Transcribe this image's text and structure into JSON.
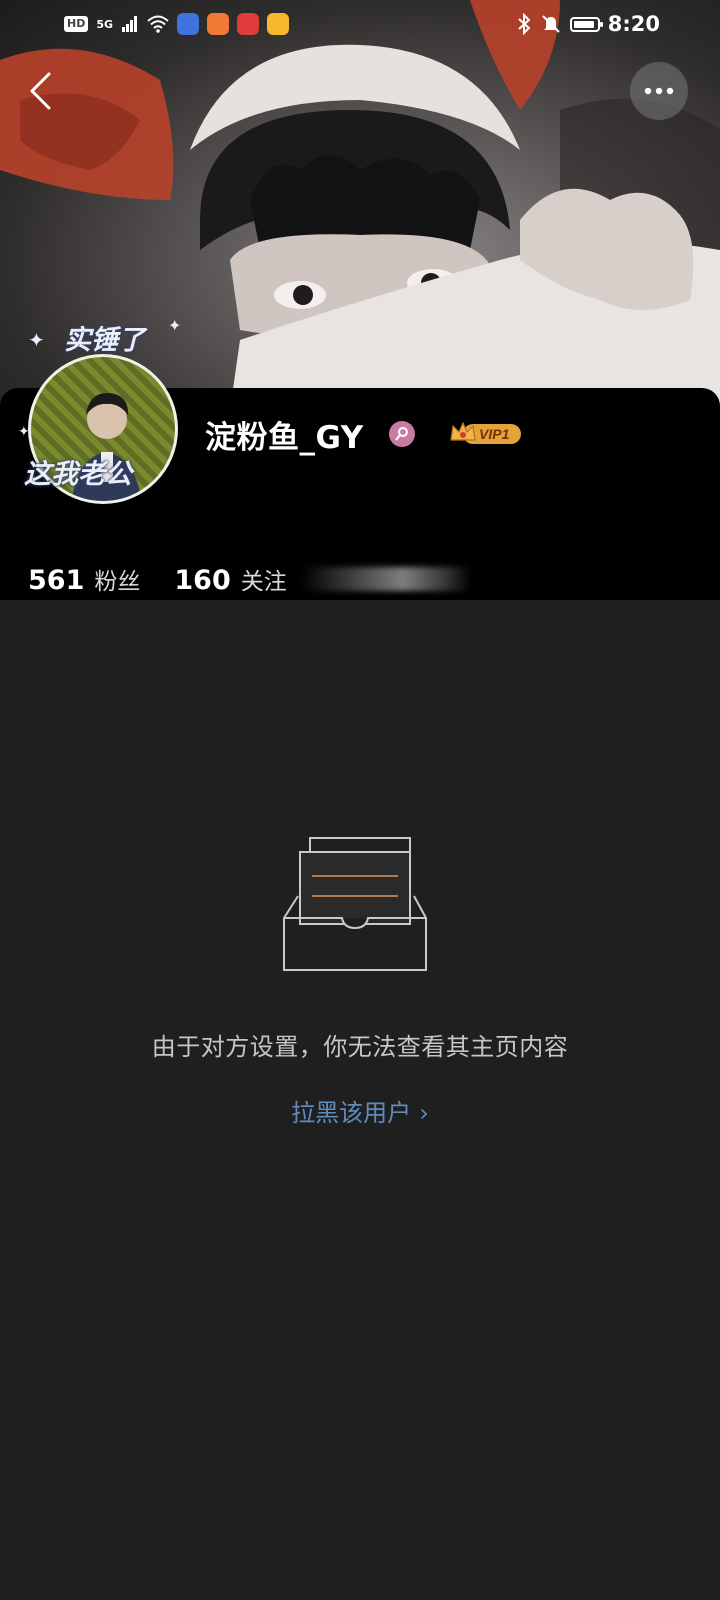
{
  "status_bar": {
    "hd_label": "HD",
    "network_label": "5G",
    "time": "8:20",
    "icons": [
      "signal-icon",
      "wifi-icon",
      "app-icon-blue",
      "app-icon-orange",
      "app-icon-red",
      "weibo-icon",
      "bluetooth-icon",
      "mute-icon",
      "battery-icon"
    ]
  },
  "nav": {
    "back_icon": "chevron-left-icon",
    "more_icon": "more-dots-icon"
  },
  "profile": {
    "avatar_frame_top_text": "实锤了",
    "avatar_frame_bottom_text": "这我老公",
    "username": "淀粉鱼_GY",
    "gender_icon": "female-icon",
    "gender_color": "#c77da1",
    "vip_label": "VIP1",
    "stats": {
      "followers_count": "561",
      "followers_label": "粉丝",
      "following_count": "160",
      "following_label": "关注"
    }
  },
  "empty_state": {
    "icon": "empty-inbox-icon",
    "message": "由于对方设置，你无法查看其主页内容",
    "block_link_label": "拉黑该用户",
    "block_link_color": "#5f8bbd"
  },
  "colors": {
    "page_background": "#1f1f1f",
    "card_background": "#000000"
  }
}
